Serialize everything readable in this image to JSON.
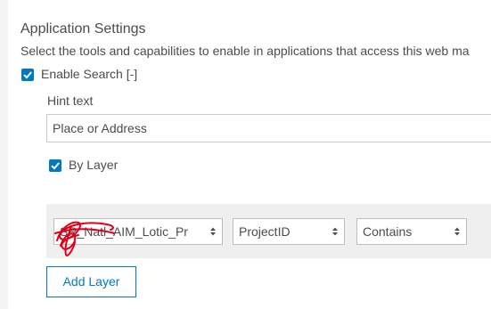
{
  "settings": {
    "title": "Application Settings",
    "description": "Select the tools and capabilities to enable in applications that access this web ma"
  },
  "search": {
    "enable_label": "Enable Search [-]",
    "enabled": true,
    "hint_label": "Hint text",
    "hint_value": "Place or Address",
    "by_layer_label": "By Layer",
    "by_layer_enabled": true
  },
  "layer_row": {
    "layer_select": "SR_Natl_AIM_Lotic_Pr",
    "field_select": "ProjectID",
    "operator_select": "Contains"
  },
  "add_layer_label": "Add Layer",
  "colors": {
    "accent": "#0079c1",
    "scribble": "#e0001b"
  }
}
